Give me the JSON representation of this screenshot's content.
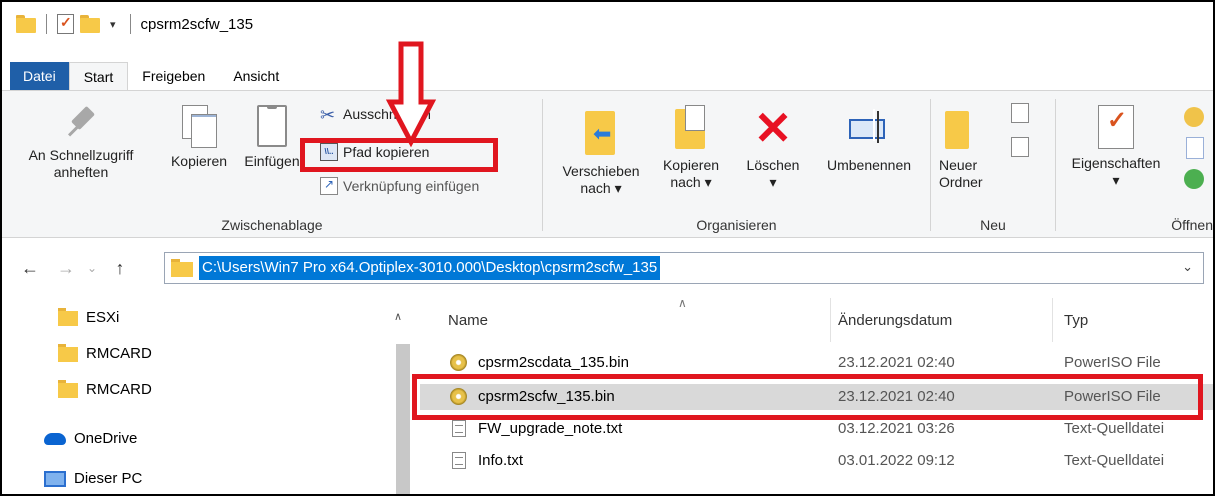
{
  "window": {
    "title": "cpsrm2scfw_135"
  },
  "tabs": [
    {
      "label": "Datei"
    },
    {
      "label": "Start"
    },
    {
      "label": "Freigeben"
    },
    {
      "label": "Ansicht"
    }
  ],
  "ribbon": {
    "clipboard": {
      "label": "Zwischenablage",
      "pin_label_1": "An Schnellzugriff",
      "pin_label_2": "anheften",
      "copy_label": "Kopieren",
      "paste_label": "Einfügen",
      "cut_label": "Ausschneiden",
      "copy_path_label": "Pfad kopieren",
      "paste_shortcut_label": "Verknüpfung einfügen"
    },
    "organize": {
      "label": "Organisieren",
      "move_label_1": "Verschieben",
      "move_label_2": "nach ▾",
      "copyto_label_1": "Kopieren",
      "copyto_label_2": "nach ▾",
      "delete_label_1": "Löschen",
      "delete_label_2": "▾",
      "rename_label": "Umbenennen"
    },
    "new": {
      "label": "Neu",
      "new_folder_label_1": "Neuer",
      "new_folder_label_2": "Ordner"
    },
    "open": {
      "label": "Öffnen",
      "properties_label": "Eigenschaften",
      "properties_arrow": "▾"
    }
  },
  "address": {
    "path": "C:\\Users\\Win7 Pro x64.Optiplex-3010.000\\Desktop\\cpsrm2scfw_135"
  },
  "sidebar": {
    "items": [
      {
        "label": "ESXi"
      },
      {
        "label": "RMCARD"
      },
      {
        "label": "RMCARD"
      },
      {
        "label": "OneDrive"
      },
      {
        "label": "Dieser PC"
      }
    ]
  },
  "file_list": {
    "columns": {
      "name": "Name",
      "date": "Änderungsdatum",
      "type": "Typ"
    },
    "rows": [
      {
        "name": "cpsrm2scdata_135.bin",
        "date": "23.12.2021 02:40",
        "type": "PowerISO File"
      },
      {
        "name": "cpsrm2scfw_135.bin",
        "date": "23.12.2021 02:40",
        "type": "PowerISO File"
      },
      {
        "name": "FW_upgrade_note.txt",
        "date": "03.12.2021 03:26",
        "type": "Text-Quelldatei"
      },
      {
        "name": "Info.txt",
        "date": "03.01.2022 09:12",
        "type": "Text-Quelldatei"
      }
    ]
  },
  "colors": {
    "highlight": "#e0161f",
    "file_tab": "#1f5fa8",
    "selection": "#0078d7"
  }
}
